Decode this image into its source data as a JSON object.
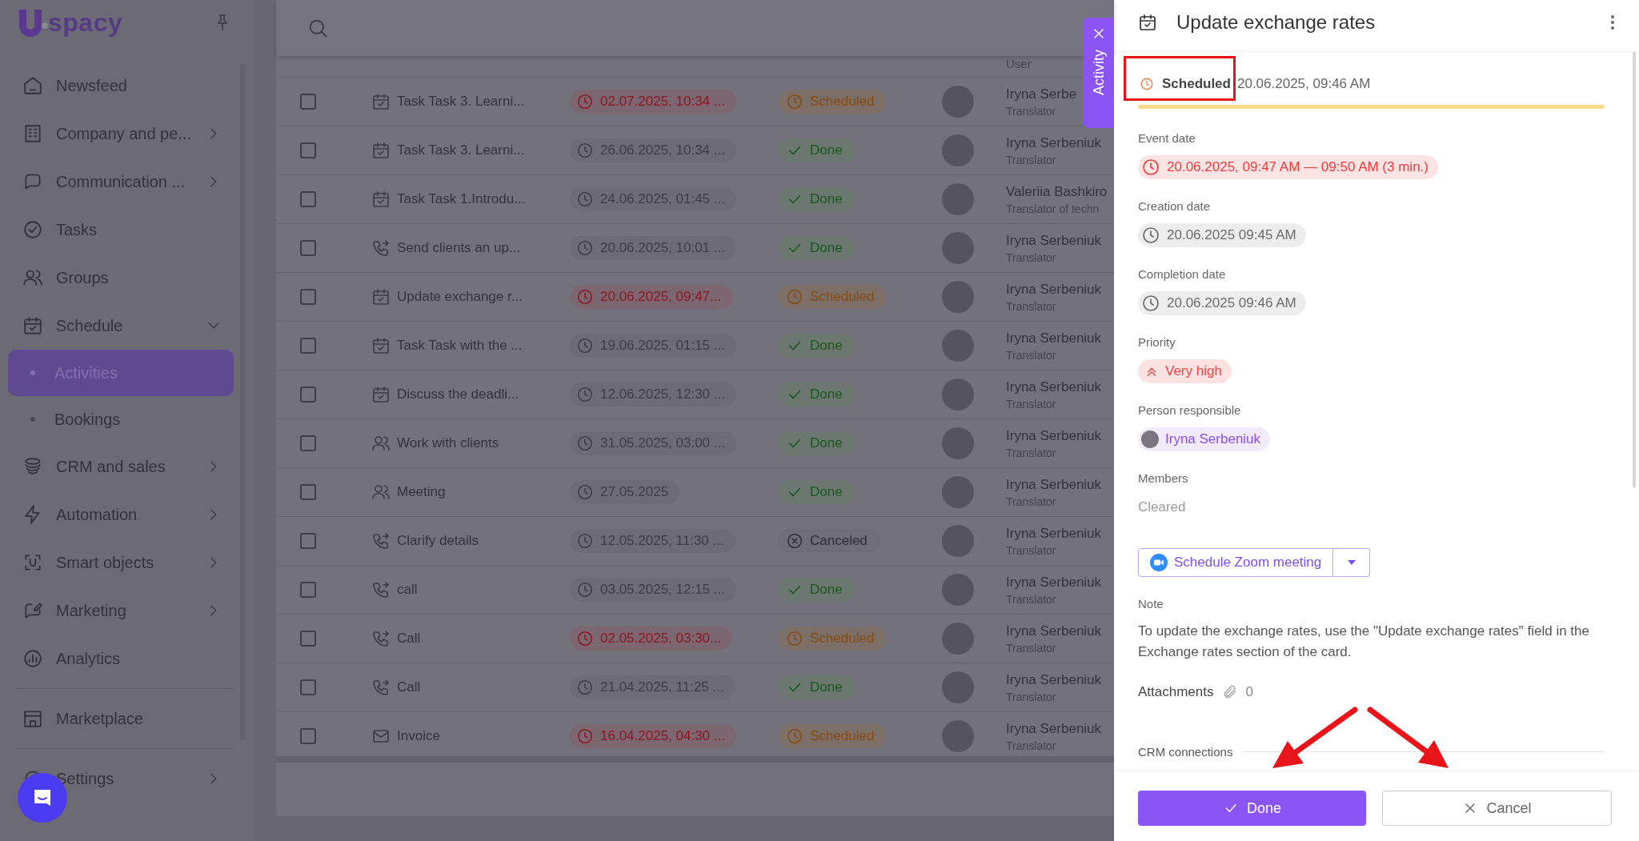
{
  "sidebar": {
    "logo_text": "spacy",
    "items": [
      {
        "label": "Newsfeed",
        "submenu": false,
        "selected": false,
        "divider_before": false
      },
      {
        "label": "Company and pe...",
        "submenu": true,
        "selected": false,
        "divider_before": false
      },
      {
        "label": "Communication ...",
        "submenu": true,
        "selected": false,
        "divider_before": false
      },
      {
        "label": "Tasks",
        "submenu": false,
        "selected": false,
        "divider_before": false
      },
      {
        "label": "Groups",
        "submenu": false,
        "selected": false,
        "divider_before": false
      },
      {
        "label": "Schedule",
        "submenu": true,
        "expanded": true,
        "selected": false,
        "divider_before": false,
        "children": [
          {
            "label": "Activities",
            "selected": true
          },
          {
            "label": "Bookings",
            "selected": false
          }
        ]
      },
      {
        "label": "CRM and sales",
        "submenu": true,
        "selected": false,
        "divider_before": false
      },
      {
        "label": "Automation",
        "submenu": true,
        "selected": false,
        "divider_before": false
      },
      {
        "label": "Smart objects",
        "submenu": true,
        "selected": false,
        "divider_before": false
      },
      {
        "label": "Marketing",
        "submenu": true,
        "selected": false,
        "divider_before": false
      },
      {
        "label": "Analytics",
        "submenu": false,
        "selected": false,
        "divider_before": false
      },
      {
        "label": "Marketplace",
        "submenu": false,
        "selected": false,
        "divider_before": true
      },
      {
        "label": "Settings",
        "submenu": true,
        "selected": false,
        "divider_before": true
      }
    ]
  },
  "table": {
    "partial_row": {
      "role": "User"
    },
    "rows": [
      {
        "kind": "task",
        "title": "Task Task 3. Learni...",
        "date": "02.07.2025, 10:34 ...",
        "overdue": true,
        "status": {
          "kind": "scheduled",
          "label": "Scheduled"
        },
        "person": "Iryna Serbe",
        "role": "Translator",
        "checked": false
      },
      {
        "kind": "task",
        "title": "Task Task 3. Learni...",
        "date": "26.06.2025, 10:34 ...",
        "overdue": false,
        "status": {
          "kind": "done",
          "label": "Done"
        },
        "person": "Iryna Serbeniuk",
        "role": "Translator",
        "checked": false
      },
      {
        "kind": "task",
        "title": "Task Task 1.Introdu...",
        "date": "24.06.2025, 01:45 ...",
        "overdue": false,
        "status": {
          "kind": "done",
          "label": "Done"
        },
        "person": "Valeriia Bashkiro",
        "role": "Translator of techn",
        "checked": false
      },
      {
        "kind": "call",
        "title": "Send clients an up...",
        "date": "20.06.2025, 10:01 ...",
        "overdue": false,
        "status": {
          "kind": "done",
          "label": "Done"
        },
        "person": "Iryna Serbeniuk",
        "role": "Translator",
        "checked": false
      },
      {
        "kind": "task",
        "title": "Update exchange r...",
        "date": "20.06.2025, 09:47...",
        "overdue": true,
        "status": {
          "kind": "scheduled",
          "label": "Scheduled"
        },
        "person": "Iryna Serbeniuk",
        "role": "Translator",
        "checked": false
      },
      {
        "kind": "task",
        "title": "Task Task with the ...",
        "date": "19.06.2025, 01:15 ...",
        "overdue": false,
        "status": {
          "kind": "done",
          "label": "Done"
        },
        "person": "Iryna Serbeniuk",
        "role": "Translator",
        "checked": false
      },
      {
        "kind": "task",
        "title": "Discuss the deadli...",
        "date": "12.06.2025, 12:30 ...",
        "overdue": false,
        "status": {
          "kind": "done",
          "label": "Done"
        },
        "person": "Iryna Serbeniuk",
        "role": "Translator",
        "checked": false
      },
      {
        "kind": "meeting",
        "title": "Work with clients",
        "date": "31.05.2025, 03:00 ...",
        "overdue": false,
        "status": {
          "kind": "done",
          "label": "Done"
        },
        "person": "Iryna Serbeniuk",
        "role": "Translator",
        "checked": false
      },
      {
        "kind": "meeting",
        "title": "Meeting",
        "date": "27.05.2025",
        "overdue": false,
        "status": {
          "kind": "done",
          "label": "Done"
        },
        "person": "Iryna Serbeniuk",
        "role": "Translator",
        "checked": false
      },
      {
        "kind": "call",
        "title": "Clarify details",
        "date": "12.05.2025, 11:30 ...",
        "overdue": false,
        "status": {
          "kind": "canceled",
          "label": "Canceled"
        },
        "person": "Iryna Serbeniuk",
        "role": "Translator",
        "checked": false
      },
      {
        "kind": "call",
        "title": "call",
        "date": "03.05.2025, 12:15 ...",
        "overdue": false,
        "status": {
          "kind": "done",
          "label": "Done"
        },
        "person": "Iryna Serbeniuk",
        "role": "Translator",
        "checked": false
      },
      {
        "kind": "call",
        "title": "Call",
        "date": "02.05.2025, 03:30...",
        "overdue": true,
        "status": {
          "kind": "scheduled",
          "label": "Scheduled"
        },
        "person": "Iryna Serbeniuk",
        "role": "Translator",
        "checked": false
      },
      {
        "kind": "call",
        "title": "Call",
        "date": "21.04.2025, 11:25 ...",
        "overdue": false,
        "status": {
          "kind": "done",
          "label": "Done"
        },
        "person": "Iryna Serbeniuk",
        "role": "Translator",
        "checked": false
      },
      {
        "kind": "email",
        "title": "Invoice",
        "date": "16.04.2025, 04:30 ...",
        "overdue": true,
        "status": {
          "kind": "scheduled",
          "label": "Scheduled"
        },
        "person": "Iryna Serbeniuk",
        "role": "Translator",
        "checked": false
      }
    ]
  },
  "panel": {
    "activity_tab": {
      "label": "Activity"
    },
    "title": "Update exchange rates",
    "status": {
      "kind": "scheduled",
      "label": "Scheduled",
      "date": "20.06.2025, 09:46 AM",
      "level": 1
    },
    "fields": [
      {
        "kind": "date",
        "label": "Event date",
        "value": "20.06.2025, 09:47 AM — 09:50 AM (3 min.)",
        "overdue": true
      },
      {
        "kind": "date",
        "label": "Creation date",
        "value": "20.06.2025 09:45 AM",
        "overdue": false
      },
      {
        "kind": "date",
        "label": "Completion date",
        "value": "20.06.2025 09:46 AM",
        "overdue": false
      },
      {
        "kind": "priority",
        "label": "Priority",
        "value": "Very high"
      },
      {
        "kind": "person",
        "label": "Person responsible",
        "value": "Iryna Serbeniuk"
      },
      {
        "kind": "text",
        "label": "Members",
        "value": "Cleared"
      }
    ],
    "zoom_button": "Schedule Zoom meeting",
    "note": {
      "label": "Note",
      "text": "To update the exchange rates, use the \"Update exchange rates\" field in the Exchange rates section of the card."
    },
    "attachments": {
      "label": "Attachments",
      "count": "0"
    },
    "crm_label": "CRM connections",
    "buttons": [
      {
        "kind": "primary",
        "label": "Done"
      },
      {
        "kind": "secondary",
        "label": "Cancel"
      }
    ]
  },
  "annotations": [
    {
      "kind": "box"
    },
    {
      "kind": "arrow_left"
    },
    {
      "kind": "arrow_right"
    }
  ]
}
